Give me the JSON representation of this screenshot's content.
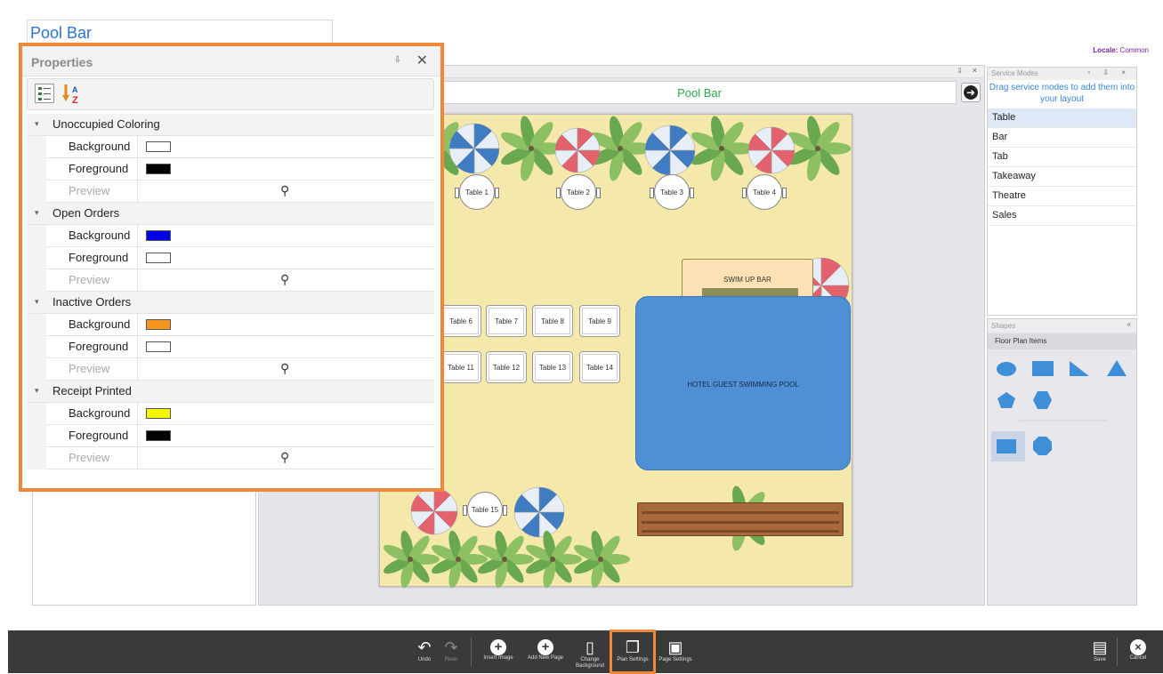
{
  "title": "Pool Bar",
  "locale": {
    "label": "Locale:",
    "value": "Common"
  },
  "designer": {
    "page_title": "Pool Bar",
    "pin": "⇩",
    "close": "×"
  },
  "floor_plan": {
    "tables_round": [
      "Table 1",
      "Table 2",
      "Table 3",
      "Table 4",
      "Table 15"
    ],
    "tables_square": [
      "Table 6",
      "Table 7",
      "Table 8",
      "Table 9",
      "Table 11",
      "Table 12",
      "Table 13",
      "Table 14"
    ],
    "bar_label": "SWIM UP BAR",
    "pool_label": "HOTEL GUEST SWIMMING POOL",
    "colors": {
      "sand": "#f4e9aa",
      "pool": "#4e8fd6",
      "palm": "#6aa84f",
      "umbrella_blue": "#3f7cc2",
      "umbrella_red": "#e3626e"
    }
  },
  "properties": {
    "title": "Properties",
    "pin": "⇩",
    "close": "✕",
    "sort_icon": "sort-az-icon",
    "categories": [
      {
        "name": "Unoccupied Coloring",
        "rows": [
          {
            "name": "Background",
            "color": "#ffffff"
          },
          {
            "name": "Foreground",
            "color": "#000000"
          },
          {
            "name": "Preview"
          }
        ]
      },
      {
        "name": "Open Orders",
        "rows": [
          {
            "name": "Background",
            "color": "#0000e6"
          },
          {
            "name": "Foreground",
            "color": "#ffffff"
          },
          {
            "name": "Preview"
          }
        ]
      },
      {
        "name": "Inactive Orders",
        "rows": [
          {
            "name": "Background",
            "color": "#f5961e"
          },
          {
            "name": "Foreground",
            "color": "#ffffff"
          },
          {
            "name": "Preview"
          }
        ]
      },
      {
        "name": "Receipt Printed",
        "rows": [
          {
            "name": "Background",
            "color": "#f5f500"
          },
          {
            "name": "Foreground",
            "color": "#000000"
          },
          {
            "name": "Preview"
          }
        ]
      }
    ]
  },
  "service_modes": {
    "title": "Service Modes",
    "controls": "▫ ⇩ ×",
    "hint": "Drag service modes to add them into your layout",
    "items": [
      "Table",
      "Bar",
      "Tab",
      "Takeaway",
      "Theatre",
      "Sales"
    ],
    "selected": "Table"
  },
  "shapes": {
    "title": "Shapes",
    "collapse": "«",
    "category": "Floor Plan Items",
    "items": [
      "ellipse-icon",
      "rectangle-icon",
      "right-triangle-icon",
      "triangle-icon",
      "pentagon-icon",
      "hexagon-icon",
      "rectangle-icon",
      "octagon-icon"
    ]
  },
  "toolbar": {
    "undo": "Undo",
    "redo": "Redo",
    "insert_image": "Insert Image",
    "add_new_page": "Add New Page",
    "change_background": "Change Background",
    "plan_settings": "Plan Settings",
    "page_settings": "Page Settings",
    "save": "Save",
    "cancel": "Cancel",
    "highlight_color": "#f0883a"
  }
}
